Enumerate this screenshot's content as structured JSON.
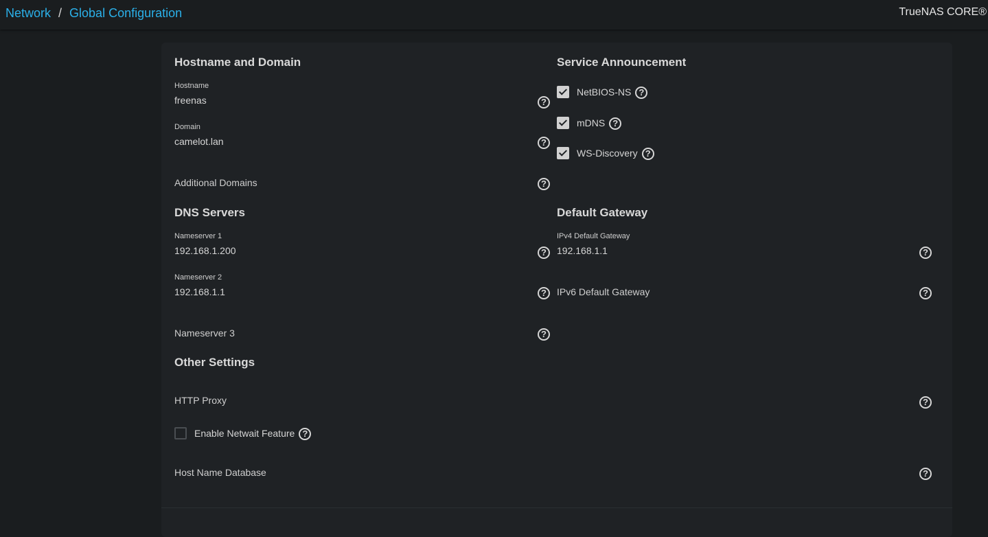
{
  "breadcrumb": {
    "items": [
      "Network",
      "Global Configuration"
    ],
    "separator": "/"
  },
  "brand": "TrueNAS CORE®",
  "help_icon_glyph": "?",
  "hostname_domain": {
    "title": "Hostname and Domain",
    "hostname": {
      "label": "Hostname",
      "value": "freenas"
    },
    "domain": {
      "label": "Domain",
      "value": "camelot.lan"
    },
    "additional_domains": {
      "placeholder": "Additional Domains"
    }
  },
  "service_announcement": {
    "title": "Service Announcement",
    "items": [
      {
        "label": "NetBIOS-NS",
        "checked": true
      },
      {
        "label": "mDNS",
        "checked": true
      },
      {
        "label": "WS-Discovery",
        "checked": true
      }
    ]
  },
  "dns_servers": {
    "title": "DNS Servers",
    "nameserver1": {
      "label": "Nameserver 1",
      "value": "192.168.1.200"
    },
    "nameserver2": {
      "label": "Nameserver 2",
      "value": "192.168.1.1"
    },
    "nameserver3": {
      "placeholder": "Nameserver 3"
    }
  },
  "default_gateway": {
    "title": "Default Gateway",
    "ipv4": {
      "label": "IPv4 Default Gateway",
      "value": "192.168.1.1"
    },
    "ipv6": {
      "placeholder": "IPv6 Default Gateway"
    }
  },
  "other_settings": {
    "title": "Other Settings",
    "http_proxy": {
      "placeholder": "HTTP Proxy"
    },
    "netwait": {
      "label": "Enable Netwait Feature",
      "checked": false
    },
    "host_name_database": {
      "placeholder": "Host Name Database"
    }
  },
  "colors": {
    "accent": "#2bb0e9",
    "background": "#1a1d1f",
    "card": "#1f2225",
    "text": "#d6d6d6"
  }
}
